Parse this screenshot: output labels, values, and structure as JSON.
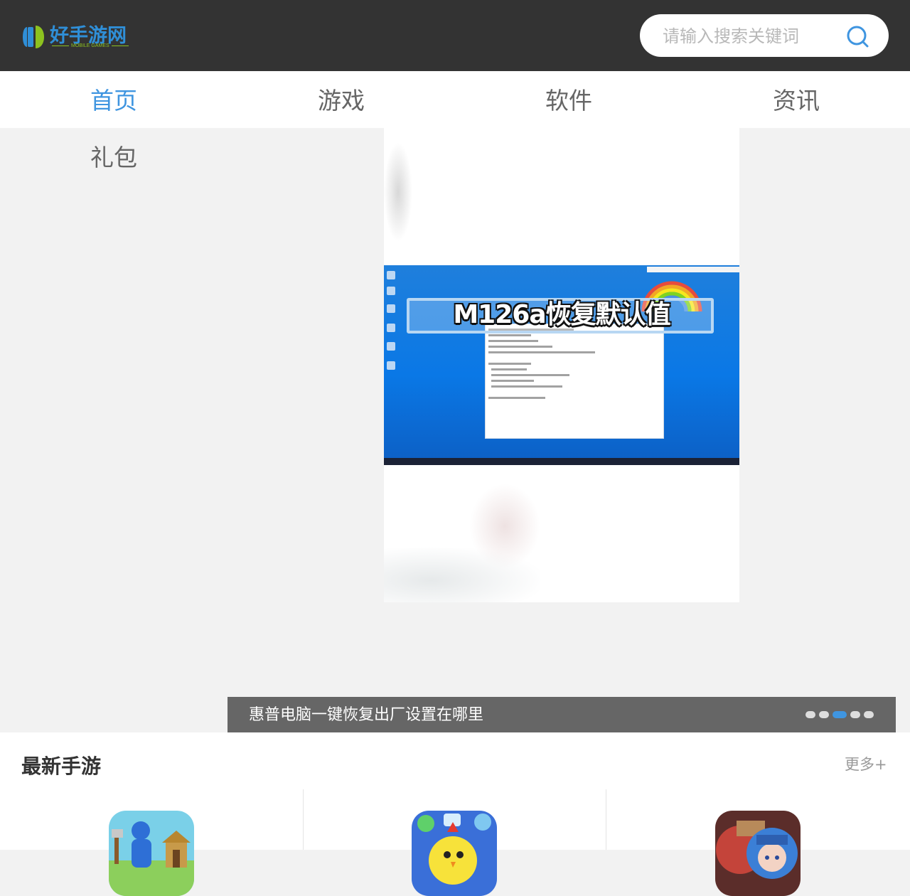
{
  "header": {
    "logo": {
      "title": "好手游网",
      "subtitle": "MOBILE GAMES"
    },
    "search": {
      "placeholder": "请输入搜索关键词",
      "icon": "search-icon"
    }
  },
  "nav": {
    "items": [
      {
        "label": "首页",
        "active": true
      },
      {
        "label": "游戏",
        "active": false
      },
      {
        "label": "软件",
        "active": false
      },
      {
        "label": "资讯",
        "active": false
      },
      {
        "label": "礼包",
        "active": false
      }
    ],
    "active_color": "#3f95e0"
  },
  "banner": {
    "image_caption": "M126a恢复默认值",
    "title": "惠普电脑一键恢复出厂设置在哪里",
    "slide_count": 5,
    "active_slide": 3
  },
  "latest_games": {
    "title": "最新手游",
    "more_label": "更多+",
    "games": [
      {
        "icon": "game-icon-lumberjack"
      },
      {
        "icon": "game-icon-chicken"
      },
      {
        "icon": "game-icon-anime-girl"
      }
    ]
  },
  "colors": {
    "header_bg": "#333333",
    "accent": "#3f95e0",
    "logo_green": "#8dc21f"
  }
}
